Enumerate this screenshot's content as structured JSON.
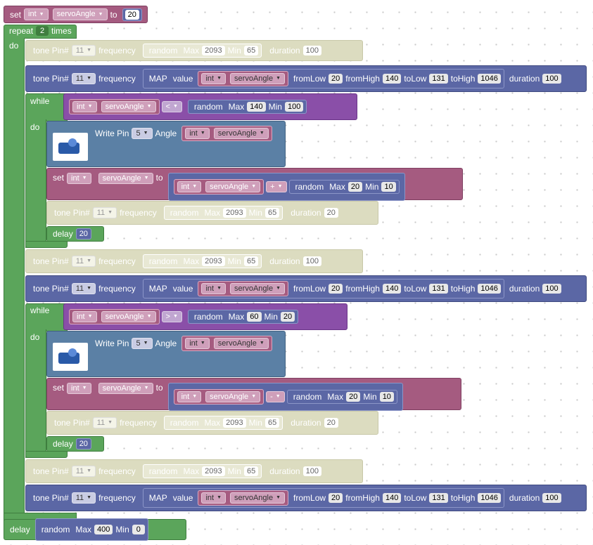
{
  "colors": {
    "variable": "#a55b80",
    "control": "#5ba55b",
    "tone": "#5b67a5",
    "disabled": "#dcdcc0",
    "logic": "#8a4fa8",
    "servo": "#5b80a5"
  },
  "set": {
    "label": "set",
    "type": "int",
    "var": "servoAngle",
    "to": "to",
    "value": "20"
  },
  "repeat": {
    "label": "repeat",
    "count": "2",
    "times": "times",
    "do": "do"
  },
  "kw": {
    "tone_pin": "tone Pin#",
    "frequency": "frequency",
    "random": "random",
    "max": "Max",
    "min": "Min",
    "duration": "duration",
    "map": "MAP",
    "value": "value",
    "from_low": "fromLow",
    "from_high": "fromHigh",
    "to_low": "toLow",
    "to_high": "toHigh",
    "while": "while",
    "do": "do",
    "write_pin": "Write Pin",
    "angle": "Angle",
    "set": "set",
    "to": "to",
    "delay": "delay",
    "int": "int",
    "servo_angle": "servoAngle"
  },
  "vals": {
    "pin": "11",
    "servo_pin": "5",
    "rmax": "2093",
    "rmin": "65",
    "dur": "100",
    "dur2": "20",
    "fl": "20",
    "fh": "140",
    "tl": "131",
    "th": "1046",
    "lt": "<",
    "gt": ">",
    "plus": "+",
    "minus": "-",
    "w1max": "140",
    "w1min": "100",
    "w2max": "60",
    "w2min": "20",
    "incmax": "20",
    "incmin": "10",
    "delay": "20",
    "fmax": "400",
    "fmin": "0"
  }
}
